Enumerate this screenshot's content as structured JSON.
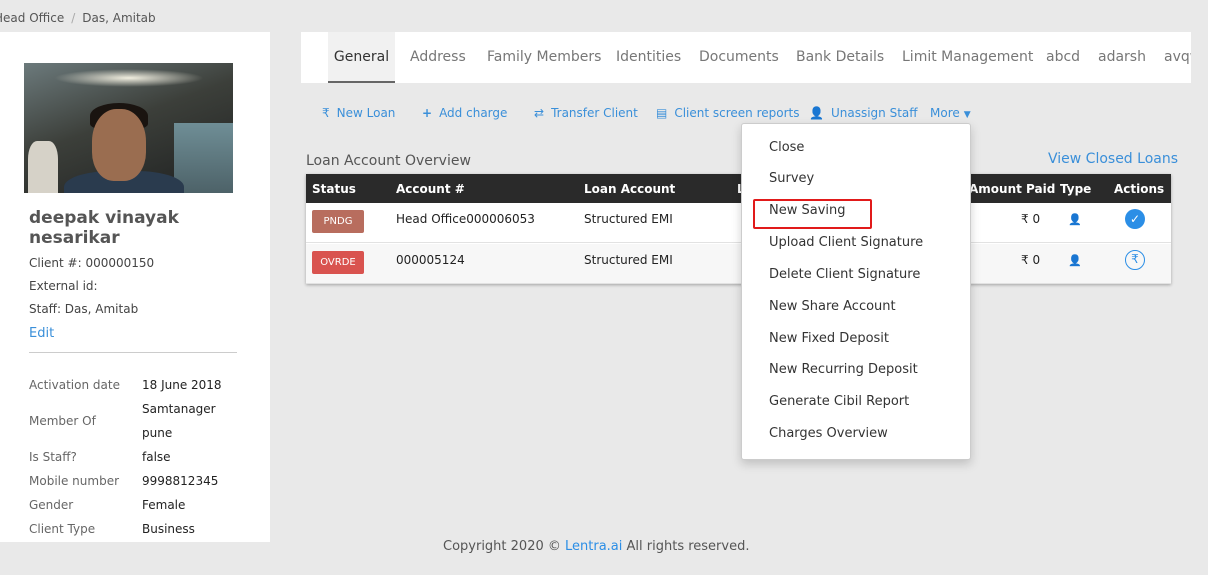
{
  "breadcrumb": {
    "items": [
      "Head Office",
      "Das, Amitab"
    ]
  },
  "client": {
    "name": "deepak vinayak nesarikar",
    "client_no": "Client #: 000000150",
    "external_id": "External id:",
    "staff": "Staff: Das, Amitab",
    "edit_label": "Edit",
    "details": [
      {
        "label": "Activation date",
        "value": "18 June 2018"
      },
      {
        "label": "Member Of",
        "value_line1": "Samtanager",
        "value_line2": "pune"
      },
      {
        "label": "Is Staff?",
        "value": "false"
      },
      {
        "label": "Mobile number",
        "value": "9998812345"
      },
      {
        "label": "Gender",
        "value": "Female"
      },
      {
        "label": "Client Type",
        "value": "Business"
      }
    ]
  },
  "tabs": [
    "General",
    "Address",
    "Family Members",
    "Identities",
    "Documents",
    "Bank Details",
    "Limit Management",
    "abcd",
    "adarsh",
    "avqw"
  ],
  "actions": {
    "new_loan": "New Loan",
    "add_charge": "Add charge",
    "transfer_client": "Transfer Client",
    "client_screen_reports": "Client screen reports",
    "unassign_staff": "Unassign Staff",
    "more": "More"
  },
  "loans": {
    "title": "Loan Account Overview",
    "view_closed": "View Closed Loans",
    "headers": [
      "Status",
      "Account #",
      "Loan Account",
      "L",
      "Amount Paid",
      "Type",
      "Actions"
    ],
    "rows": [
      {
        "status": "PNDG",
        "status_color": "#b86d5e",
        "account": "Head Office000006053",
        "loan_account": "Structured EMI",
        "amount_paid": "₹ 0"
      },
      {
        "status": "OVRDE",
        "status_color": "#d9534f",
        "account": "000005124",
        "loan_account": "Structured EMI",
        "amount_paid": "₹ 0"
      }
    ]
  },
  "more_menu": {
    "items": [
      "Close",
      "Survey",
      "New Saving",
      "Upload Client Signature",
      "Delete Client Signature",
      "New Share Account",
      "New Fixed Deposit",
      "New Recurring Deposit",
      "Generate Cibil Report",
      "Charges Overview"
    ],
    "highlighted": "New Saving"
  },
  "footer": {
    "prefix": "Copyright 2020 © ",
    "brand": "Lentra.ai",
    "suffix": " All rights reserved."
  },
  "colors": {
    "accent": "#2b8ee6",
    "header_bg": "#2a2a2a",
    "highlight": "#e11a1a"
  },
  "icons": {
    "new_loan": "rupee-icon",
    "add_charge": "plus-icon",
    "transfer_client": "transfer-arrows-icon",
    "client_screen_reports": "document-icon",
    "unassign_staff": "user-icon",
    "more": "caret-down-icon",
    "row_type": "user-icon",
    "row_action_1": "check-circle-icon",
    "row_action_2": "rupee-refresh-icon"
  }
}
